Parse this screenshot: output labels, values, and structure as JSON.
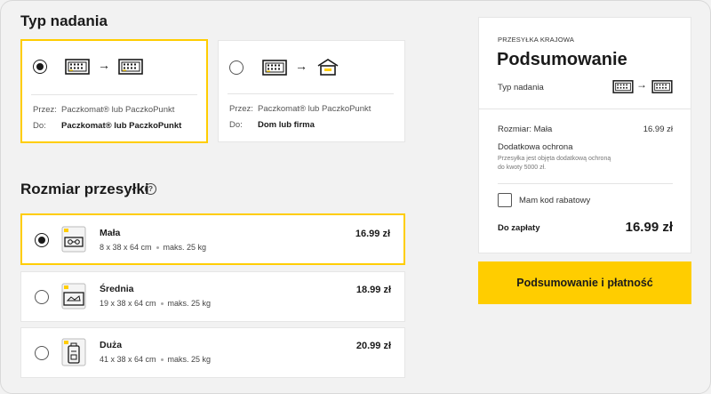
{
  "delivery": {
    "title": "Typ nadania",
    "options": [
      {
        "from_label": "Przez:",
        "from_value": "Paczkomat® lub PaczkoPunkt",
        "to_label": "Do:",
        "to_value": "Paczkomat® lub PaczkoPunkt",
        "selected": true
      },
      {
        "from_label": "Przez:",
        "from_value": "Paczkomat® lub PaczkoPunkt",
        "to_label": "Do:",
        "to_value": "Dom lub firma",
        "selected": false
      }
    ],
    "arrow": "→"
  },
  "size": {
    "title": "Rozmiar przesyłki",
    "help": "?",
    "options": [
      {
        "name": "Mała",
        "dims": "8 x 38 x 64 cm",
        "weight": "maks. 25 kg",
        "price": "16.99 zł",
        "selected": true
      },
      {
        "name": "Średnia",
        "dims": "19 x 38 x 64 cm",
        "weight": "maks. 25 kg",
        "price": "18.99 zł",
        "selected": false
      },
      {
        "name": "Duża",
        "dims": "41 x 38 x 64 cm",
        "weight": "maks. 25 kg",
        "price": "20.99 zł",
        "selected": false
      }
    ]
  },
  "summary": {
    "eyebrow": "PRZESYŁKA KRAJOWA",
    "title": "Podsumowanie",
    "delivery_type_label": "Typ nadania",
    "size_line": "Rozmiar: Mała",
    "size_price": "16.99 zł",
    "protection_title": "Dodatkowa ochrona",
    "protection_desc_1": "Przesyłka jest objęta dodatkową ochroną",
    "protection_desc_2": "do kwoty 5000 zł.",
    "coupon_label": "Mam kod rabatowy",
    "total_label": "Do zapłaty",
    "total_value": "16.99 zł",
    "cta": "Podsumowanie i płatność"
  },
  "colors": {
    "accent": "#ffcd00",
    "background": "#f2f2f2"
  }
}
